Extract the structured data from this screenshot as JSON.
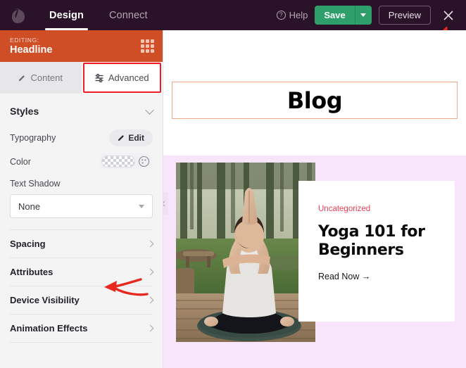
{
  "topbar": {
    "logo_icon": "leaf-logo-icon",
    "tabs": [
      {
        "label": "Design",
        "active": true
      },
      {
        "label": "Connect",
        "active": false
      }
    ],
    "help_label": "Help",
    "help_icon": "question-circle-icon",
    "save_label": "Save",
    "save_caret_icon": "chevron-down-icon",
    "preview_label": "Preview",
    "close_icon": "close-icon",
    "bg_color": "#2a1229",
    "save_color": "#2e9e6b"
  },
  "sidebar": {
    "editing": {
      "eyebrow": "EDITING:",
      "name": "Headline",
      "bg_color": "#cf4e26",
      "handle_icon": "drag-dots-icon"
    },
    "tabs": [
      {
        "label": "Content",
        "icon": "pencil-icon",
        "active": false
      },
      {
        "label": "Advanced",
        "icon": "sliders-icon",
        "active": true,
        "annotated": true
      }
    ],
    "styles": {
      "title": "Styles",
      "collapse_icon": "chevron-down-icon",
      "typography_label": "Typography",
      "typography_edit_label": "Edit",
      "typography_edit_icon": "pencil-icon",
      "color_label": "Color",
      "color_value": "transparent",
      "color_picker_icon": "palette-icon",
      "text_shadow_label": "Text Shadow",
      "text_shadow_value": "None",
      "text_shadow_caret_icon": "chevron-down-icon"
    },
    "sections": [
      {
        "label": "Spacing",
        "icon": "chevron-right-icon"
      },
      {
        "label": "Attributes",
        "icon": "chevron-right-icon"
      },
      {
        "label": "Device Visibility",
        "icon": "chevron-right-icon",
        "annotated": true
      },
      {
        "label": "Animation Effects",
        "icon": "chevron-right-icon"
      }
    ]
  },
  "annotations": {
    "arrow_color": "#e8281f",
    "arrow_device_visibility": "red-arrow-pointing-to-device-visibility",
    "arrow_top_right": "red-arrow-partial-top-right"
  },
  "canvas": {
    "page_heading": "Blog",
    "heading_box_border": "#eda88c",
    "pink_bg": "#f9e5fb",
    "collapse_icon": "chevron-left-icon",
    "post": {
      "image_alt": "woman-doing-yoga-outdoors-photo",
      "category": "Uncategorized",
      "category_color": "#ef4056",
      "title": "Yoga 101 for Beginners",
      "read_more_label": "Read Now →"
    }
  }
}
